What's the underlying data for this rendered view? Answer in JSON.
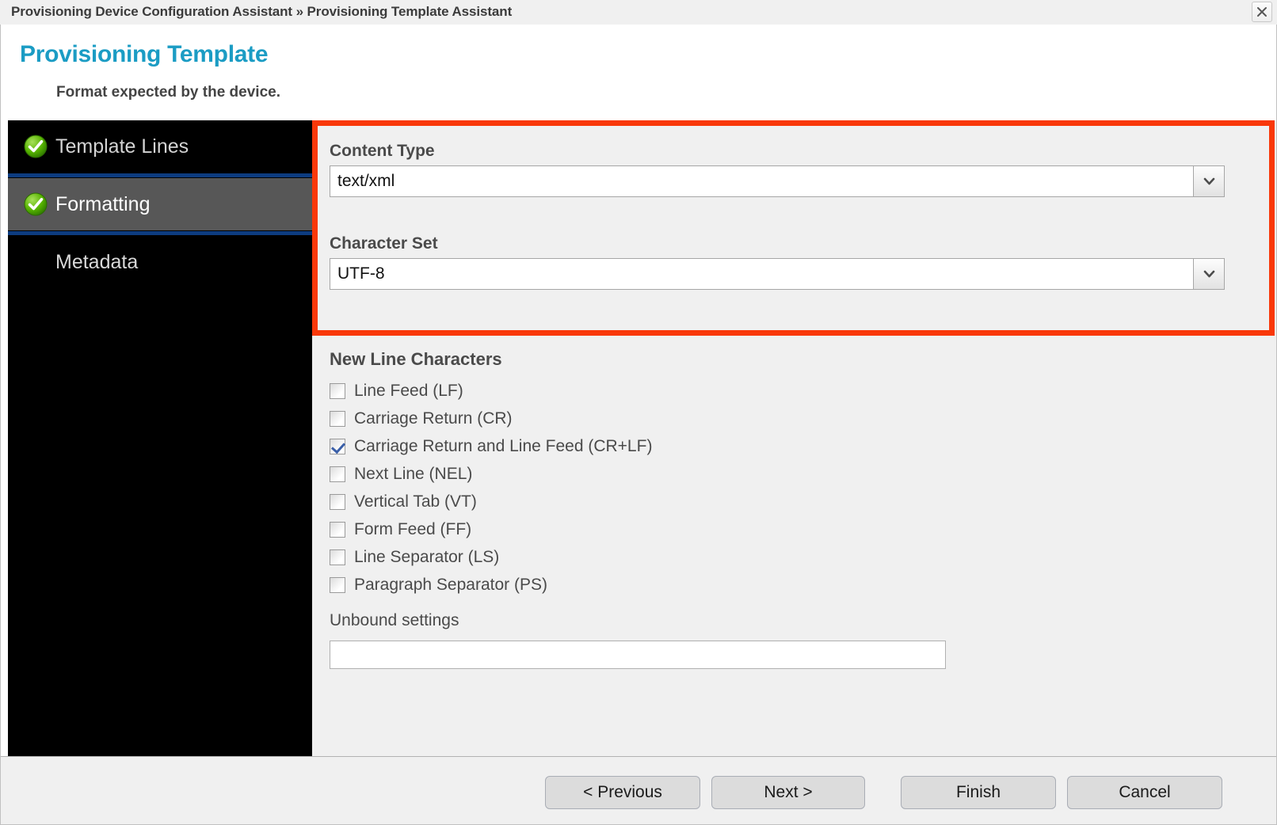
{
  "titlebar": {
    "breadcrumb": "Provisioning Device Configuration Assistant » Provisioning Template Assistant",
    "close_icon": "close-icon"
  },
  "banner": {
    "title": "Provisioning Template",
    "subtitle": "Format expected by the device.",
    "title_color": "#1b9cc4"
  },
  "sidebar": {
    "items": [
      {
        "label": "Template Lines",
        "completed": true,
        "active": false
      },
      {
        "label": "Formatting",
        "completed": true,
        "active": true
      },
      {
        "label": "Metadata",
        "completed": false,
        "active": false
      }
    ],
    "separator_color": "#0d3c80",
    "active_background": "#575757",
    "background": "#000000"
  },
  "main": {
    "highlight_color": "#f93809",
    "content_type": {
      "label": "Content Type",
      "value": "text/xml",
      "arrow_icon": "chevron-down-icon"
    },
    "character_set": {
      "label": "Character Set",
      "value": "UTF-8",
      "arrow_icon": "chevron-down-icon"
    },
    "new_line_characters": {
      "label": "New Line Characters",
      "options": [
        {
          "label": "Line Feed (LF)",
          "checked": false
        },
        {
          "label": "Carriage Return (CR)",
          "checked": false
        },
        {
          "label": "Carriage Return and Line Feed (CR+LF)",
          "checked": true
        },
        {
          "label": "Next Line (NEL)",
          "checked": false
        },
        {
          "label": "Vertical Tab (VT)",
          "checked": false
        },
        {
          "label": "Form Feed (FF)",
          "checked": false
        },
        {
          "label": "Line Separator (LS)",
          "checked": false
        },
        {
          "label": "Paragraph Separator (PS)",
          "checked": false
        }
      ]
    },
    "unbound_settings": {
      "label": "Unbound settings",
      "value": "",
      "placeholder": ""
    }
  },
  "footer": {
    "previous_label": "< Previous",
    "next_label": "Next >",
    "finish_label": "Finish",
    "cancel_label": "Cancel"
  }
}
